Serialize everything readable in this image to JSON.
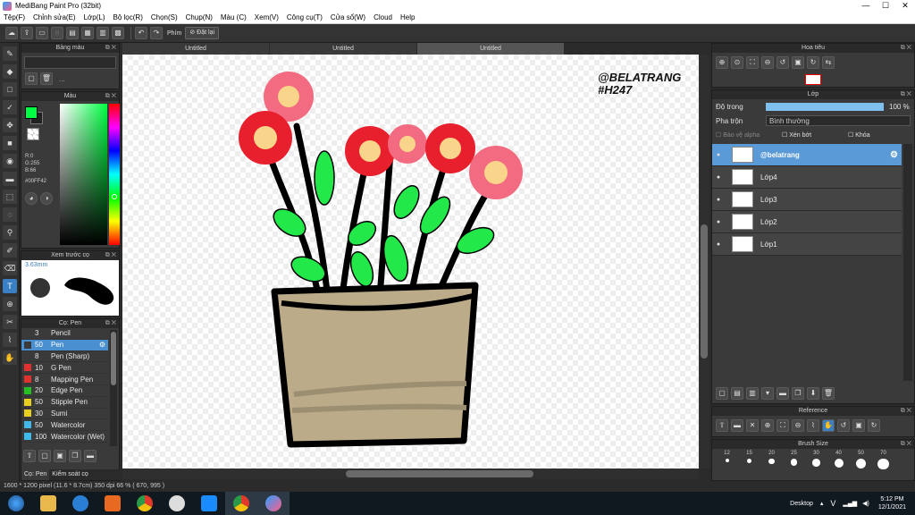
{
  "window": {
    "title": "MediBang Paint Pro (32bit)",
    "minimize": "—",
    "maximize": "☐",
    "close": "✕"
  },
  "menu": [
    "Tệp(F)",
    "Chỉnh sửa(E)",
    "Lớp(L)",
    "Bộ lọc(R)",
    "Chọn(S)",
    "Chụp(N)",
    "Màu (C)",
    "Xem(V)",
    "Công cụ(T)",
    "Cửa sổ(W)",
    "Cloud",
    "Help"
  ],
  "toolbar": {
    "shortcut_label": "Phím",
    "reset_label": "Đặt lại"
  },
  "panels": {
    "palette": "Bảng màu",
    "palette_more": "...",
    "color": "Màu",
    "brush_preview": "Xem trước cọ",
    "brush": "Cọ: Pen",
    "brush_control": "Kiểm soát cọ",
    "brush_tab": "Cọ: Pen",
    "navigator": "Hoa tiêu",
    "layer": "Lớp",
    "reference": "Reference",
    "brush_size": "Brush Size"
  },
  "color": {
    "r": "R:0",
    "g": "G:255",
    "b": "B:66",
    "hex": "#00FF42",
    "current": "#00ff42"
  },
  "brush_preview": {
    "size": "3.63mm"
  },
  "brushes": [
    {
      "size": "3",
      "name": "Pencil",
      "swatch": "#3a3a3a"
    },
    {
      "size": "50",
      "name": "Pen",
      "swatch": "#3a3a3a",
      "selected": true
    },
    {
      "size": "8",
      "name": "Pen (Sharp)",
      "swatch": "#3a3a3a"
    },
    {
      "size": "10",
      "name": "G Pen",
      "swatch": "#e03030"
    },
    {
      "size": "8",
      "name": "Mapping Pen",
      "swatch": "#e03030"
    },
    {
      "size": "20",
      "name": "Edge Pen",
      "swatch": "#22c022"
    },
    {
      "size": "50",
      "name": "Stipple Pen",
      "swatch": "#e8d020"
    },
    {
      "size": "30",
      "name": "Sumi",
      "swatch": "#e8d020"
    },
    {
      "size": "50",
      "name": "Watercolor",
      "swatch": "#40b8e8"
    },
    {
      "size": "100",
      "name": "Watercolor (Wet)",
      "swatch": "#40b8e8"
    }
  ],
  "tabs": [
    "Untitled",
    "Untitled",
    "Untitled"
  ],
  "canvas": {
    "watermark_line1": "@BELATRANG",
    "watermark_line2": "#H247"
  },
  "layers": {
    "opacity_label": "Độ trong",
    "opacity_value": "100 %",
    "opacity": 1.0,
    "blend_label": "Pha trộn",
    "blend_value": "Bình thường",
    "protect_alpha": "Bảo vệ alpha",
    "clipping": "Xén bớt",
    "lock": "Khóa",
    "items": [
      {
        "name": "@belatrang",
        "selected": true
      },
      {
        "name": "Lớp4"
      },
      {
        "name": "Lớp3"
      },
      {
        "name": "Lớp2"
      },
      {
        "name": "Lớp1"
      }
    ]
  },
  "brush_sizes": [
    "12",
    "15",
    "20",
    "25",
    "30",
    "40",
    "50",
    "70"
  ],
  "status": "1600 * 1200 pixel  (11.6 * 8.7cm)  350 dpi  66 %  ( 670, 995 )",
  "taskbar": {
    "desktop": "Desktop",
    "lang": "V",
    "time": "5:12 PM",
    "date": "12/1/2021"
  }
}
